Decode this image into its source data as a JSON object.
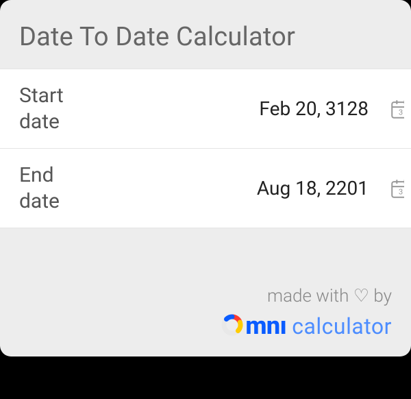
{
  "header": {
    "title": "Date To Date Calculator"
  },
  "fields": {
    "start": {
      "label": "Start date",
      "value": "Feb 20, 3128"
    },
    "end": {
      "label": "End date",
      "value": "Aug 18, 2201"
    }
  },
  "footer": {
    "tagline": "made with ♡ by",
    "brand_main": "mnı",
    "brand_sub": "calculator"
  }
}
